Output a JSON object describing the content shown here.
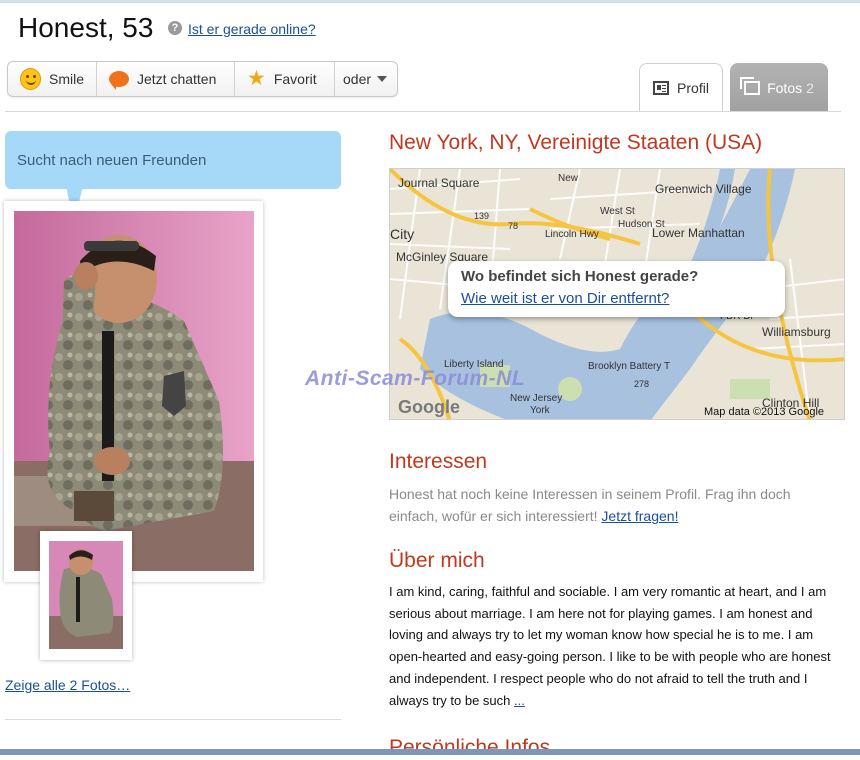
{
  "profile": {
    "name_age": "Honest, 53",
    "online_link": "Ist er gerade online?",
    "status_bubble": "Sucht nach neuen Freunden",
    "all_photos_link": "Zeige alle 2 Fotos…"
  },
  "actions": [
    {
      "label": "Smile",
      "icon": "smile-icon"
    },
    {
      "label": "Jetzt chatten",
      "icon": "chat-bubble-icon"
    },
    {
      "label": "Favorit",
      "icon": "star-icon"
    },
    {
      "label": "oder",
      "icon": "chevron-down-icon"
    }
  ],
  "tabs": {
    "profil": {
      "label": "Profil",
      "icon": "profile-card-icon"
    },
    "fotos": {
      "label": "Fotos",
      "count": "2",
      "icon": "photos-icon"
    }
  },
  "location": {
    "title": "New York, NY, Vereinigte Staaten (USA)",
    "map_question": "Wo befindet sich Honest gerade?",
    "map_link": "Wie weit ist er von Dir entfernt?",
    "map_credit": "Map data ©2013 Google",
    "map_logo": "Google",
    "map_labels": [
      "Journal Square",
      "Greenwich Village",
      "Lower Manhattan",
      "McGinley Square",
      "Lincoln Hwy",
      "Williamsburg",
      "Liberty Island",
      "Clinton Hill",
      "City",
      "New",
      "West St",
      "Hudson St",
      "FDR Dr",
      "Brooklyn Battery T",
      "139",
      "78",
      "278",
      "New Jersey",
      "York"
    ]
  },
  "watermark": "Anti-Scam-Forum-NL",
  "interests": {
    "title": "Interessen",
    "text": "Honest hat noch keine Interessen in seinem Profil. Frag ihn doch einfach, wofür er sich interessiert!",
    "link": "Jetzt fragen!"
  },
  "about": {
    "title": "Über mich",
    "text": "I am kind, caring, faithful and sociable. I am very romantic at heart, and I am serious about marriage. I am here not for playing games. I am honest and loving and always try to let my woman know how special he is to me. I am open-hearted and easy-going person. I like to be with people who are honest and independent. I respect people who do not afraid to tell the truth and I always try to be such",
    "more_link": "..."
  },
  "personal": {
    "title": "Persönliche Infos"
  },
  "colors": {
    "accent_red": "#c0391f",
    "link_blue": "#1a4f9c",
    "bubble_blue": "#a6d8f8",
    "tab_gray": "#a8a8a8"
  }
}
